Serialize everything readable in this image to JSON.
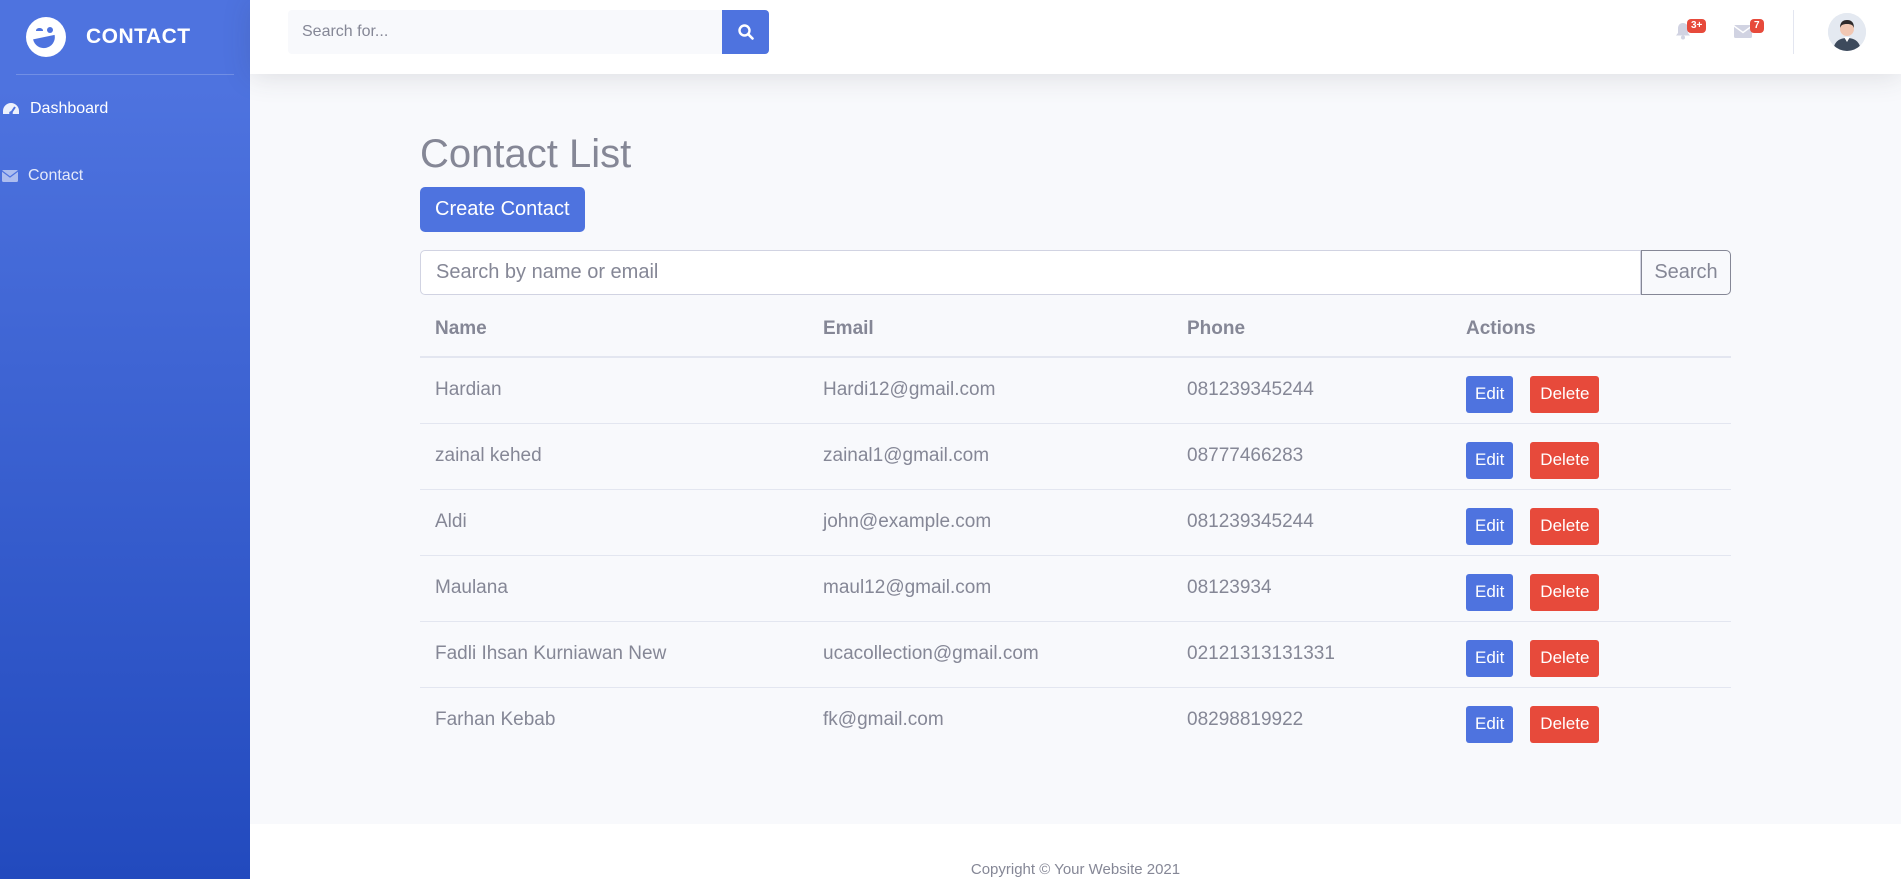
{
  "sidebar": {
    "brand": "CONTACT",
    "items": [
      {
        "label": "Dashboard",
        "icon": "tachometer-icon"
      },
      {
        "label": "Contact",
        "icon": "envelope-icon"
      }
    ]
  },
  "topbar": {
    "search_placeholder": "Search for...",
    "alerts_badge": "3+",
    "messages_badge": "7"
  },
  "main": {
    "title": "Contact List",
    "create_label": "Create Contact",
    "filter_placeholder": "Search by name or email",
    "filter_button": "Search",
    "columns": [
      "Name",
      "Email",
      "Phone",
      "Actions"
    ],
    "rows": [
      {
        "name": "Hardian",
        "email": "Hardi12@gmail.com",
        "phone": "081239345244"
      },
      {
        "name": "zainal kehed",
        "email": "zainal1@gmail.com",
        "phone": "08777466283"
      },
      {
        "name": "Aldi",
        "email": "john@example.com",
        "phone": "081239345244"
      },
      {
        "name": "Maulana",
        "email": "maul12@gmail.com",
        "phone": "08123934"
      },
      {
        "name": "Fadli Ihsan Kurniawan New",
        "email": "ucacollection@gmail.com",
        "phone": "02121313131331"
      },
      {
        "name": "Farhan Kebab",
        "email": "fk@gmail.com",
        "phone": "08298819922"
      }
    ],
    "edit_label": "Edit",
    "delete_label": "Delete"
  },
  "footer": {
    "text": "Copyright © Your Website 2021"
  },
  "colors": {
    "primary": "#4e73df",
    "danger": "#e74a3b",
    "text": "#858796"
  }
}
